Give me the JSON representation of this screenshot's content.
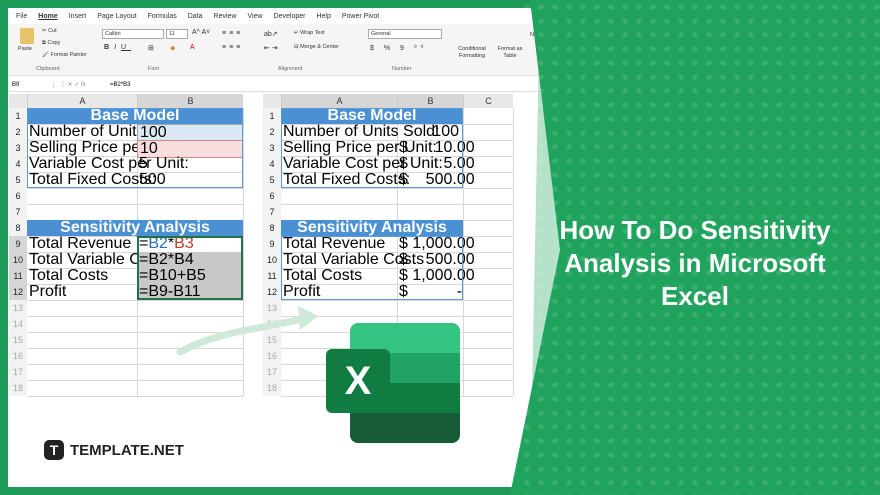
{
  "menu": [
    "File",
    "Home",
    "Insert",
    "Page Layout",
    "Formulas",
    "Data",
    "Review",
    "View",
    "Developer",
    "Help",
    "Power Pivot"
  ],
  "ribbon": {
    "paste": "Paste",
    "cut": "Cut",
    "copy": "Copy",
    "format_painter": "Format Painter",
    "clipboard": "Clipboard",
    "font_name": "Calibri",
    "font_size": "11",
    "font": "Font",
    "alignment": "Alignment",
    "wrap_text": "Wrap Text",
    "merge_center": "Merge & Center",
    "number_format": "General",
    "number": "Number",
    "conditional": "Conditional Formatting",
    "format_table": "Format as Table",
    "ne": "Ne"
  },
  "formula_bar": {
    "name_box": "B9",
    "formula": "=B2*B3"
  },
  "left_sheet": {
    "col_headers": [
      "A",
      "B"
    ],
    "rows": [
      "1",
      "2",
      "3",
      "4",
      "5",
      "6",
      "7",
      "8",
      "9",
      "10",
      "11",
      "12",
      "13",
      "14",
      "15",
      "16",
      "17",
      "18"
    ],
    "base_model": "Base Model",
    "labels": [
      "Number of Units Sold:",
      "Selling Price per Unit:",
      "Variable Cost per Unit:",
      "Total Fixed Costs:"
    ],
    "values": [
      "100",
      "10",
      "5",
      "500"
    ],
    "sensitivity": "Sensitivity Analysis",
    "sa_labels": [
      "Total Revenue",
      "Total Variable Costs",
      "Total Costs",
      "Profit"
    ],
    "sa_formulas": [
      "=B2*B3",
      "=B2*B4",
      "=B10+B5",
      "=B9-B11"
    ]
  },
  "right_sheet": {
    "col_headers": [
      "A",
      "B",
      "C"
    ],
    "base_model": "Base Model",
    "labels": [
      "Number of Units Sold:",
      "Selling Price per Unit:",
      "Variable Cost per Unit:",
      "Total Fixed Costs:"
    ],
    "values": [
      "100",
      "$      10.00",
      "$        5.00",
      "$    500.00"
    ],
    "sensitivity": "Sensitivity Analysis",
    "sa_labels": [
      "Total Revenue",
      "Total Variable Costs",
      "Total Costs",
      "Profit"
    ],
    "sa_values": [
      "$ 1,000.00",
      "$    500.00",
      "$ 1,000.00",
      "$           -"
    ]
  },
  "title": "How To Do Sensitivity Analysis in Microsoft Excel",
  "brand": {
    "mark": "T",
    "name": "TEMPLATE.NET"
  },
  "excel_logo": "X",
  "colors": {
    "header_blue": "#4a90d2",
    "excel_green": "#1e7145",
    "bg_green": "#20a35d"
  }
}
